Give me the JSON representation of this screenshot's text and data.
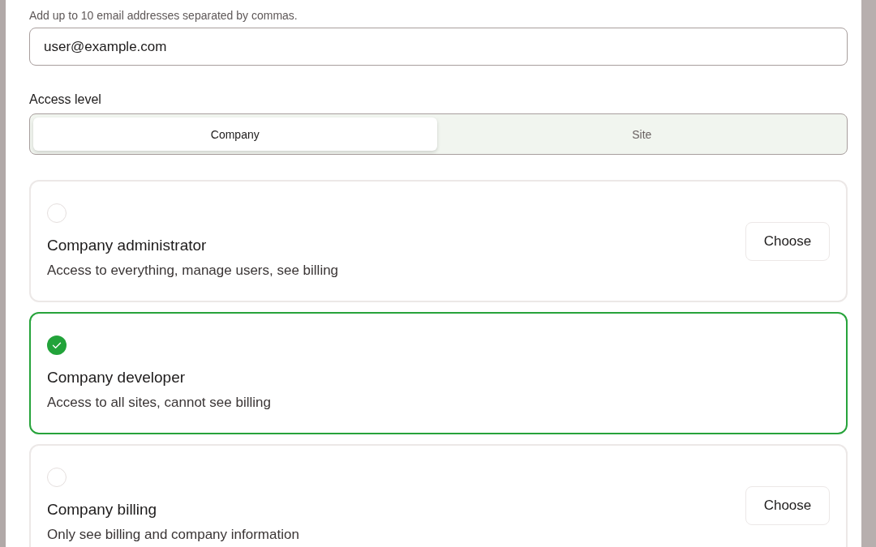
{
  "email": {
    "hint": "Add up to 10 email addresses separated by commas.",
    "value": "user@example.com"
  },
  "access_level": {
    "label": "Access level",
    "options": [
      {
        "label": "Company",
        "selected": true
      },
      {
        "label": "Site",
        "selected": false
      }
    ]
  },
  "roles": [
    {
      "title": "Company administrator",
      "description": "Access to everything, manage users, see billing",
      "selected": false,
      "button": "Choose"
    },
    {
      "title": "Company developer",
      "description": "Access to all sites, cannot see billing",
      "selected": true
    },
    {
      "title": "Company billing",
      "description": "Only see billing and company information",
      "selected": false,
      "button": "Choose"
    }
  ]
}
